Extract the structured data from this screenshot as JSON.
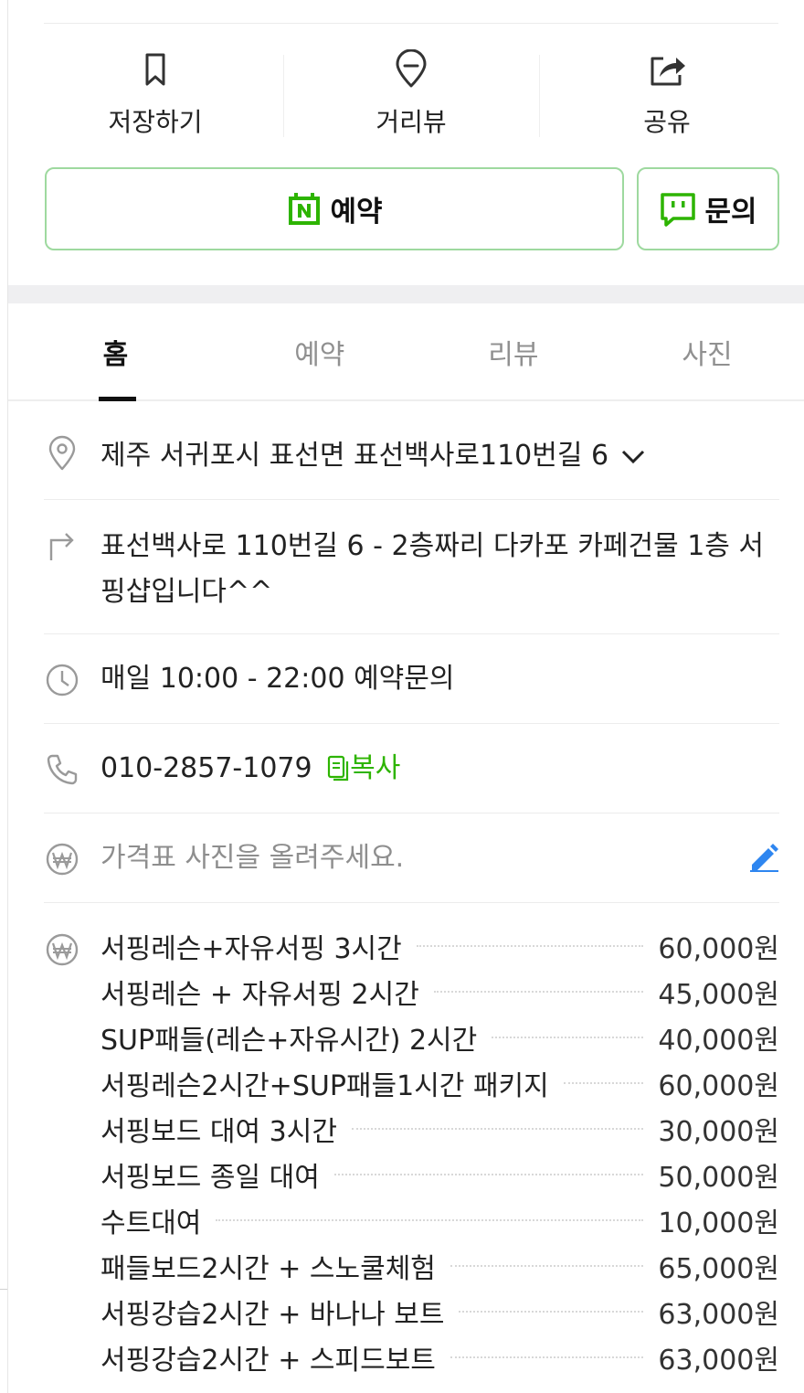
{
  "actions": {
    "save": "저장하기",
    "street_view": "거리뷰",
    "share": "공유"
  },
  "buttons": {
    "reserve": "예약",
    "inquiry": "문의",
    "accent_color": "#2db400"
  },
  "tabs": [
    "홈",
    "예약",
    "리뷰",
    "사진"
  ],
  "info": {
    "address": "제주 서귀포시 표선면 표선백사로110번길 6",
    "directions": "표선백사로 110번길 6 - 2층짜리 다카포 카페건물 1층 서핑샵입니다^^",
    "hours": "매일 10:00 - 22:00 예약문의",
    "phone": "010-2857-1079",
    "copy": "복사",
    "price_photo_prompt": "가격표 사진을 올려주세요."
  },
  "prices": [
    {
      "name": "서핑레슨+자유서핑 3시간",
      "price": "60,000원"
    },
    {
      "name": "서핑레슨 + 자유서핑 2시간",
      "price": "45,000원"
    },
    {
      "name": "SUP패들(레슨+자유시간) 2시간",
      "price": "40,000원"
    },
    {
      "name": "서핑레슨2시간+SUP패들1시간 패키지",
      "price": "60,000원"
    },
    {
      "name": "서핑보드 대여 3시간",
      "price": "30,000원"
    },
    {
      "name": "서핑보드 종일 대여",
      "price": "50,000원"
    },
    {
      "name": "수트대여",
      "price": "10,000원"
    },
    {
      "name": "패들보드2시간 + 스노쿨체험",
      "price": "65,000원"
    },
    {
      "name": "서핑강습2시간 + 바나나 보트",
      "price": "63,000원"
    },
    {
      "name": "서핑강습2시간 + 스피드보트",
      "price": "63,000원"
    }
  ]
}
